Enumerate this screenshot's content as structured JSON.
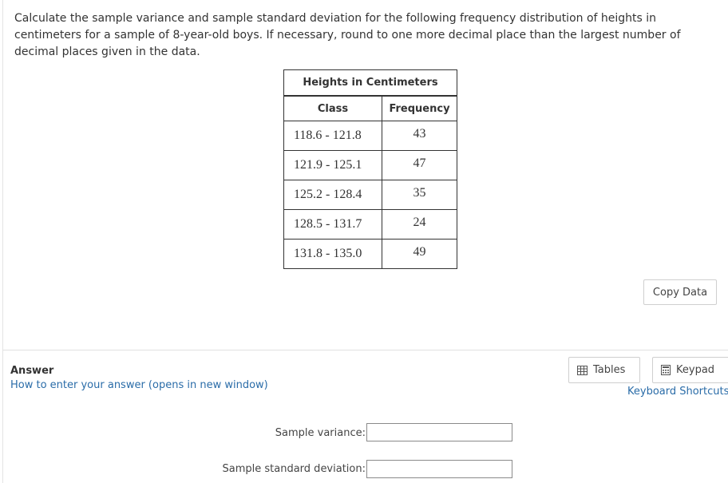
{
  "question": {
    "text": "Calculate the sample variance and sample standard deviation for the following frequency distribution of heights in centimeters for a sample of 8-year-old boys. If necessary, round to one more decimal place than the largest number of decimal places given in the data."
  },
  "table": {
    "caption": "Heights in Centimeters",
    "headers": [
      "Class",
      "Frequency"
    ],
    "rows": [
      {
        "class": "118.6 - 121.8",
        "frequency": "43"
      },
      {
        "class": "121.9 - 125.1",
        "frequency": "47"
      },
      {
        "class": "125.2 - 128.4",
        "frequency": "35"
      },
      {
        "class": "128.5 - 131.7",
        "frequency": "24"
      },
      {
        "class": "131.8 - 135.0",
        "frequency": "49"
      }
    ]
  },
  "copy_data_label": "Copy Data",
  "answer": {
    "heading": "Answer",
    "help_link": "How to enter your answer (opens in new window)",
    "tables_label": "Tables",
    "keypad_label": "Keypad",
    "shortcuts_label": "Keyboard Shortcuts",
    "variance_label": "Sample variance:",
    "stddev_label": "Sample standard deviation:",
    "variance_value": "",
    "stddev_value": ""
  },
  "icons": {
    "tables": "table-grid-icon",
    "keypad": "calculator-icon"
  }
}
